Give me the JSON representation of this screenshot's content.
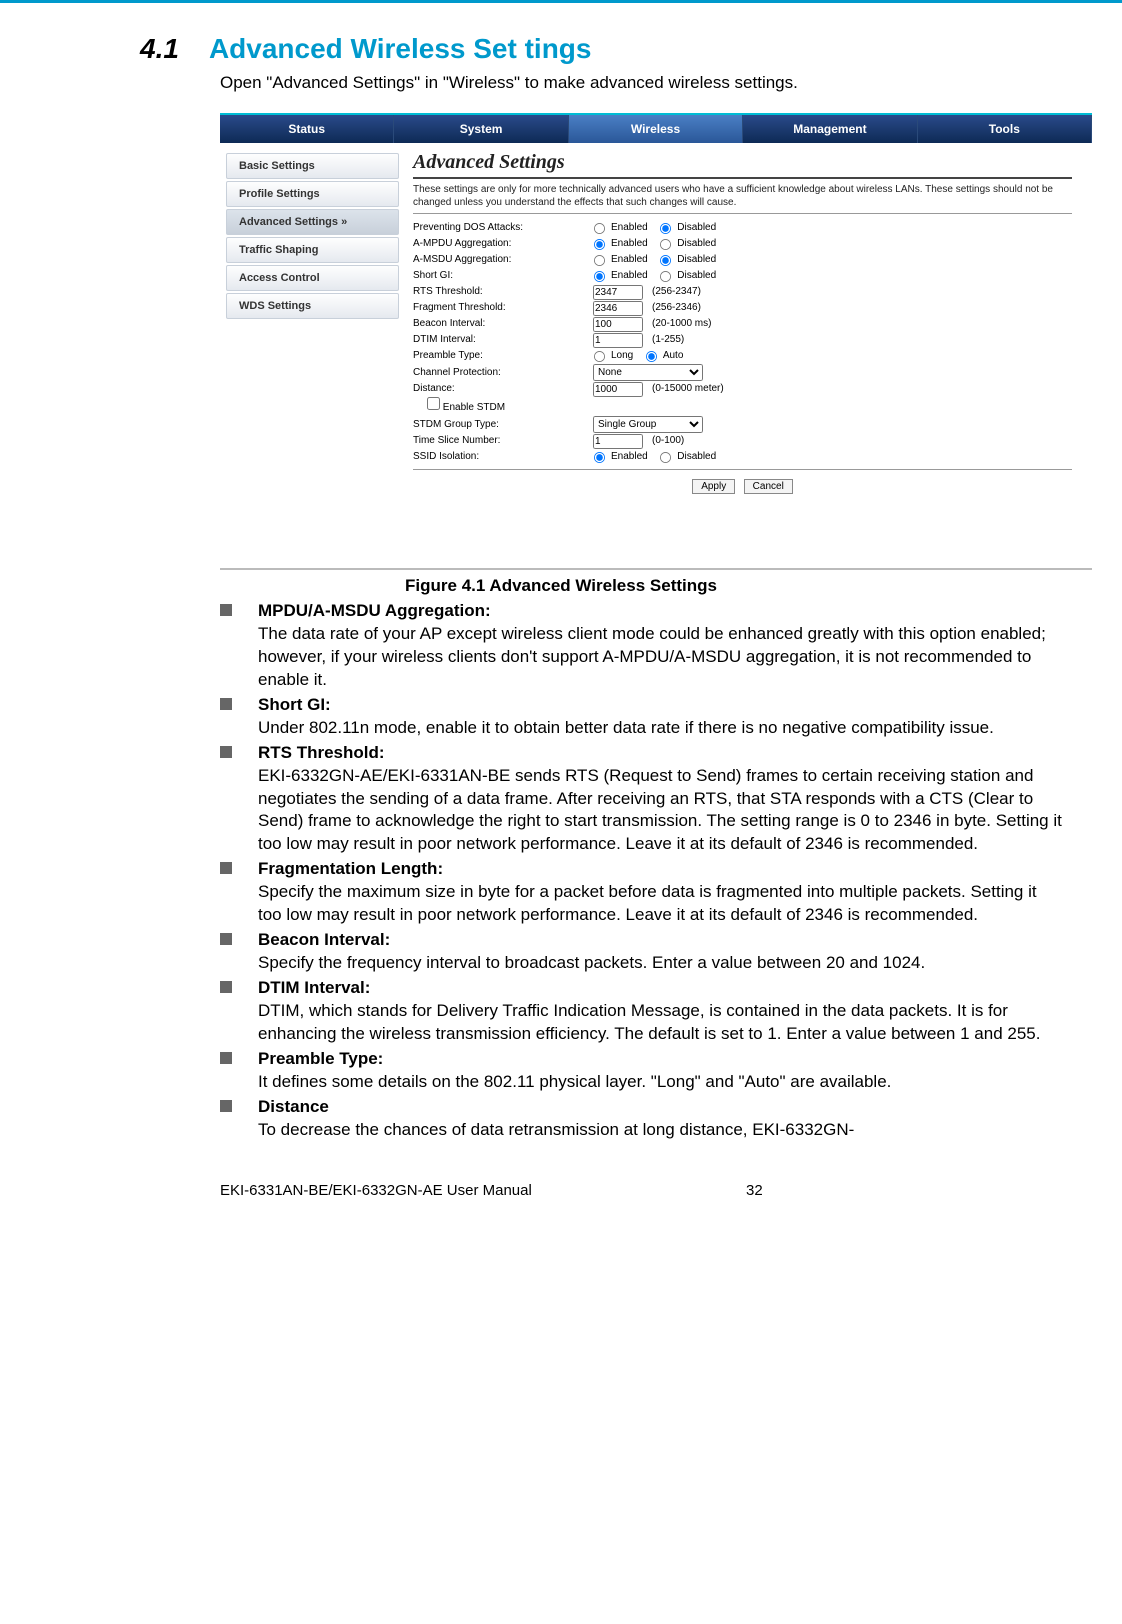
{
  "section": {
    "number": "4.1",
    "title": "Advanced Wireless Set tings"
  },
  "intro": "Open \"Advanced Settings\" in \"Wireless\" to make advanced wireless settings.",
  "nav_tabs": [
    "Status",
    "System",
    "Wireless",
    "Management",
    "Tools"
  ],
  "sidebar_items": [
    "Basic Settings",
    "Profile Settings",
    "Advanced Settings  »",
    "Traffic Shaping",
    "Access Control",
    "WDS Settings"
  ],
  "panel": {
    "title": "Advanced Settings",
    "desc": "These settings are only for more technically advanced users who have a sufficient knowledge about wireless LANs. These settings should not be changed unless you understand the effects that such changes will cause."
  },
  "settings": {
    "dos": {
      "label": "Preventing DOS Attacks:",
      "enabled": "Enabled",
      "disabled": "Disabled"
    },
    "ampdu": {
      "label": "A-MPDU Aggregation:",
      "enabled": "Enabled",
      "disabled": "Disabled"
    },
    "amsdu": {
      "label": "A-MSDU Aggregation:",
      "enabled": "Enabled",
      "disabled": "Disabled"
    },
    "shortgi": {
      "label": "Short GI:",
      "enabled": "Enabled",
      "disabled": "Disabled"
    },
    "rts": {
      "label": "RTS Threshold:",
      "value": "2347",
      "range": "(256-2347)"
    },
    "frag": {
      "label": "Fragment Threshold:",
      "value": "2346",
      "range": "(256-2346)"
    },
    "beacon": {
      "label": "Beacon Interval:",
      "value": "100",
      "range": "(20-1000 ms)"
    },
    "dtim": {
      "label": "DTIM Interval:",
      "value": "1",
      "range": "(1-255)"
    },
    "preamble": {
      "label": "Preamble Type:",
      "long": "Long",
      "auto": "Auto"
    },
    "channel_prot": {
      "label": "Channel Protection:",
      "value": "None"
    },
    "distance": {
      "label": "Distance:",
      "value": "1000",
      "range": "(0-15000 meter)"
    },
    "stdm_enable": {
      "label": "Enable STDM"
    },
    "stdm_group": {
      "label": "STDM Group Type:",
      "value": "Single Group"
    },
    "timeslice": {
      "label": "Time Slice Number:",
      "value": "1",
      "range": "(0-100)"
    },
    "ssid_iso": {
      "label": "SSID Isolation:",
      "enabled": "Enabled",
      "disabled": "Disabled"
    }
  },
  "buttons": {
    "apply": "Apply",
    "cancel": "Cancel"
  },
  "figure_caption": "Figure 4.1 Advanced Wireless Settings",
  "bullets": [
    {
      "title": "MPDU/A-MSDU Aggregation:",
      "body": "The data rate of your AP except wireless client mode could be enhanced greatly with this option enabled; however, if your wireless clients don't support A-MPDU/A-MSDU aggregation, it is not recommended to enable it."
    },
    {
      "title": "Short GI:",
      "body": "Under 802.11n mode, enable it to obtain better data rate if there is no negative compatibility issue."
    },
    {
      "title": "RTS Threshold:",
      "body": "EKI-6332GN-AE/EKI-6331AN-BE sends RTS (Request to Send) frames to certain receiving station and negotiates the sending of a data frame. After receiving an RTS, that STA responds with a CTS (Clear to Send) frame to acknowledge the right to start transmission. The setting range is 0 to 2346 in byte.  Setting it too low may result in poor network performance. Leave it at its default of 2346 is recommended."
    },
    {
      "title": "Fragmentation Length:",
      "body": "Specify the maximum size in byte for a packet before data is fragmented into multiple packets. Setting it too low may result in poor network performance. Leave it at its default of 2346 is recommended."
    },
    {
      "title": "Beacon Interval:",
      "body": "Specify the frequency interval to broadcast packets.  Enter a value between 20 and 1024."
    },
    {
      "title": "DTIM Interval:",
      "body": "DTIM, which stands for Delivery Traffic Indication Message, is contained in the data packets. It is for enhancing the wireless transmission efficiency. The default is set to 1. Enter a value between 1 and 255."
    },
    {
      "title": "Preamble Type:",
      "body": "It defines some details on the 802.11 physical layer.  \"Long\" and \"Auto\" are available."
    },
    {
      "title": "Distance",
      "body": "To decrease the chances of data retransmission at long distance, EKI-6332GN-"
    }
  ],
  "footer": {
    "manual": "EKI-6331AN-BE/EKI-6332GN-AE User Manual",
    "page": "32"
  }
}
